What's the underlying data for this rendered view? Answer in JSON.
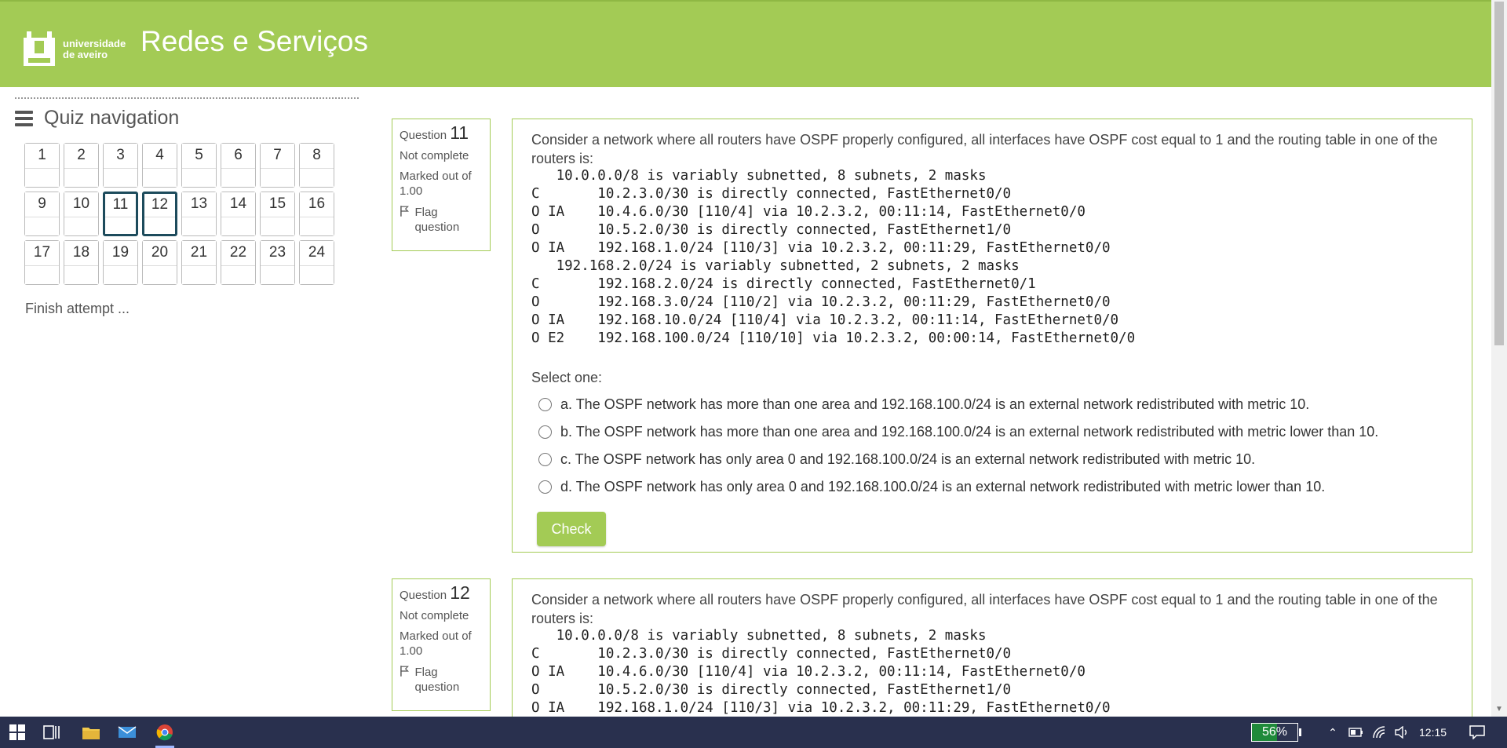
{
  "header": {
    "logo_line1": "universidade",
    "logo_line2": "de aveiro",
    "title": "Redes e Serviços"
  },
  "sidebar": {
    "heading": "Quiz navigation",
    "questions": [
      "1",
      "2",
      "3",
      "4",
      "5",
      "6",
      "7",
      "8",
      "9",
      "10",
      "11",
      "12",
      "13",
      "14",
      "15",
      "16",
      "17",
      "18",
      "19",
      "20",
      "21",
      "22",
      "23",
      "24"
    ],
    "current": [
      "11",
      "12"
    ],
    "finish": "Finish attempt ..."
  },
  "q11": {
    "label": "Question",
    "number": "11",
    "status": "Not complete",
    "marked": "Marked out of 1.00",
    "flag": "Flag question",
    "text": "Consider a network where all routers have OSPF properly configured, all interfaces have OSPF cost equal to 1 and the routing table in one of the routers is:",
    "table": [
      "   10.0.0.0/8 is variably subnetted, 8 subnets, 2 masks",
      "C       10.2.3.0/30 is directly connected, FastEthernet0/0",
      "O IA    10.4.6.0/30 [110/4] via 10.2.3.2, 00:11:14, FastEthernet0/0",
      "O       10.5.2.0/30 is directly connected, FastEthernet1/0",
      "O IA    192.168.1.0/24 [110/3] via 10.2.3.2, 00:11:29, FastEthernet0/0",
      "   192.168.2.0/24 is variably subnetted, 2 subnets, 2 masks",
      "C       192.168.2.0/24 is directly connected, FastEthernet0/1",
      "O       192.168.3.0/24 [110/2] via 10.2.3.2, 00:11:29, FastEthernet0/0",
      "O IA    192.168.10.0/24 [110/4] via 10.2.3.2, 00:11:14, FastEthernet0/0",
      "O E2    192.168.100.0/24 [110/10] via 10.2.3.2, 00:00:14, FastEthernet0/0"
    ],
    "prompt": "Select one:",
    "answers": [
      "a. The OSPF network has more than one area and 192.168.100.0/24 is an external network redistributed with metric 10.",
      "b. The OSPF network has more than one area and 192.168.100.0/24 is an external network redistributed with metric lower than 10.",
      "c. The OSPF network has only area 0 and 192.168.100.0/24 is an external network redistributed with metric 10.",
      "d. The OSPF network has only area 0 and 192.168.100.0/24 is an external network redistributed with metric lower than 10."
    ],
    "check": "Check"
  },
  "q12": {
    "label": "Question",
    "number": "12",
    "status": "Not complete",
    "marked": "Marked out of 1.00",
    "flag": "Flag question",
    "text": "Consider a network where all routers have OSPF properly configured, all interfaces have OSPF cost equal to 1 and the routing table in one of the routers is:",
    "table": [
      "   10.0.0.0/8 is variably subnetted, 8 subnets, 2 masks",
      "C       10.2.3.0/30 is directly connected, FastEthernet0/0",
      "O IA    10.4.6.0/30 [110/4] via 10.2.3.2, 00:11:14, FastEthernet0/0",
      "O       10.5.2.0/30 is directly connected, FastEthernet1/0",
      "O IA    192.168.1.0/24 [110/3] via 10.2.3.2, 00:11:29, FastEthernet0/0"
    ]
  },
  "taskbar": {
    "battery": "56%",
    "battery_level": 0.56,
    "time": "12:15"
  },
  "colors": {
    "accent": "#a3cb55",
    "current_border": "#1d4b5c",
    "taskbar": "#29304e"
  }
}
